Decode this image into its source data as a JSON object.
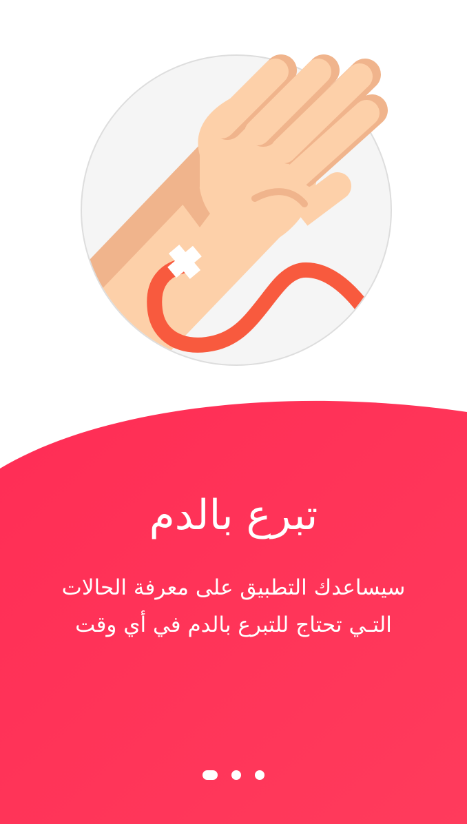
{
  "onboarding": {
    "title": "تبرع بالدم",
    "description_line1": "سيساعدك التطبيق على معرفة الحالات",
    "description_line2": "التـي تحتاج للتبرع بالدم في أي وقت",
    "illustration_icon": "hand-blood-donation-icon",
    "pager": {
      "total": 3,
      "active_index": 0
    }
  },
  "colors": {
    "accent": "#FF2D55",
    "accent_light": "#FF3B5C",
    "circle_bg": "#F5F5F5",
    "skin": "#FDD0A9",
    "skin_shadow": "#F0B48C",
    "tube": "#F85A3E",
    "tape": "#FFFFFF"
  }
}
